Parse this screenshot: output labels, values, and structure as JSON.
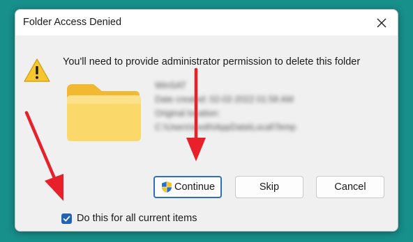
{
  "dialog": {
    "title": "Folder Access Denied",
    "message": "You'll need to provide administrator permission to delete this folder",
    "details": [
      "WinSAT",
      "Date created: 02-02-2022 01:58 AM",
      "Original location:",
      "C:\\Users\\sooth\\AppData\\Local\\Temp"
    ],
    "buttons": {
      "continue": "Continue",
      "skip": "Skip",
      "cancel": "Cancel"
    },
    "checkbox": {
      "label": "Do this for all current items",
      "checked": true
    }
  },
  "icons": {
    "close": "close-icon",
    "warning": "warning-icon",
    "folder": "folder-icon",
    "shield": "uac-shield-icon",
    "check": "checkmark-icon"
  },
  "colors": {
    "background": "#178f8b",
    "dialog": "#f0f0f0",
    "accent": "#1f63b6",
    "annotation_arrow": "#e8202a"
  }
}
